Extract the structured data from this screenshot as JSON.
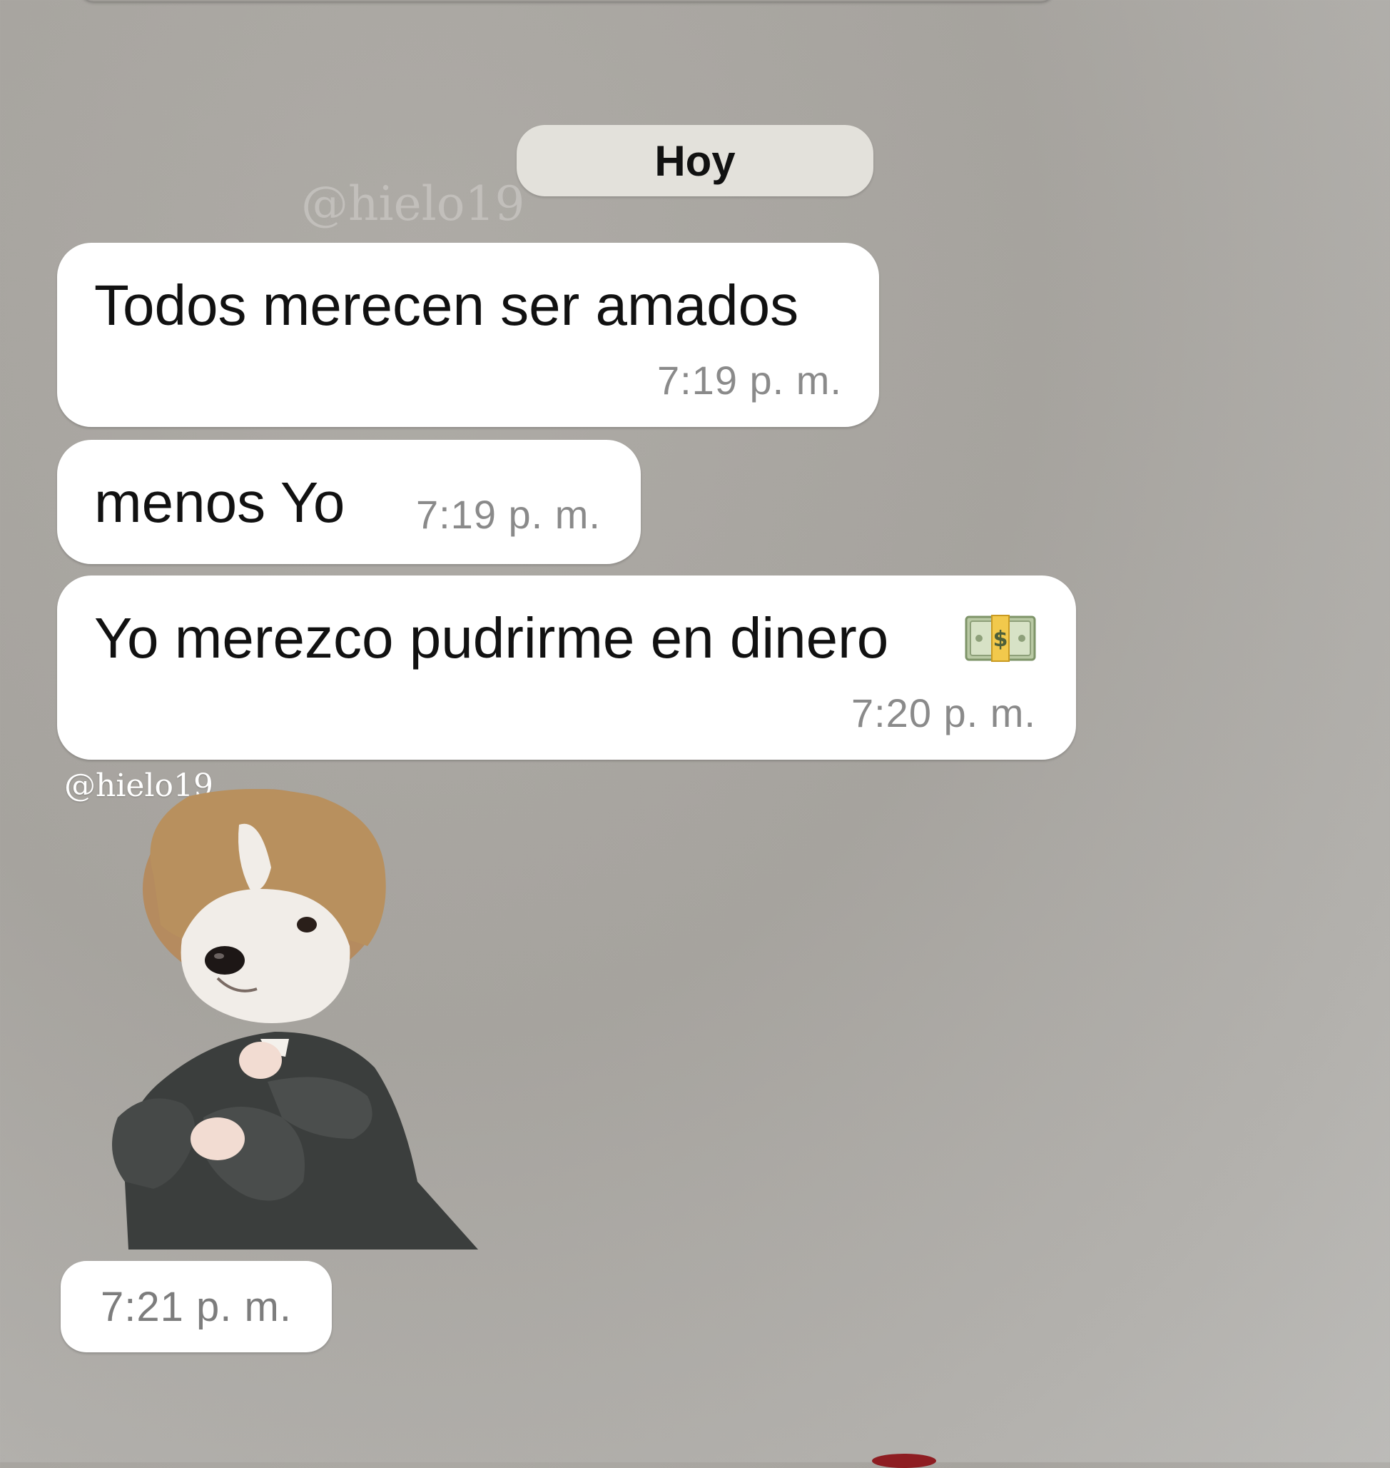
{
  "chat": {
    "date_label": "Hoy",
    "watermark": "@hielo19",
    "messages": [
      {
        "text": "Todos merecen ser amados",
        "time": "7:19 p. m."
      },
      {
        "text": "menos Yo",
        "time": "7:19 p. m."
      },
      {
        "text": "Yo merezco pudrirme en dinero",
        "time": "7:20 p. m.",
        "emoji": "money-bill-icon"
      }
    ],
    "sticker": {
      "icon": "puppy-in-suit-sticker",
      "time": "7:21 p. m."
    }
  },
  "colors": {
    "background": "#a6a39e",
    "bubble": "#ffffff",
    "date_chip": "#e3e1db",
    "time_text": "#8a8a8a"
  }
}
